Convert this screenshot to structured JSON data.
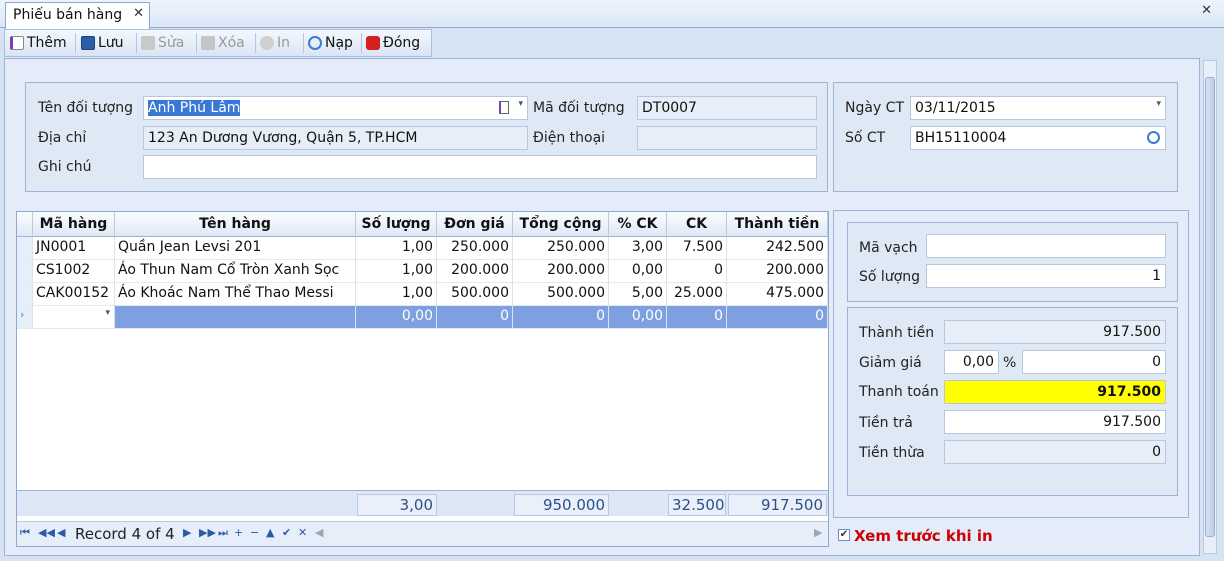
{
  "tab": {
    "title": "Phiếu bán hàng"
  },
  "toolbar": {
    "add": "Thêm",
    "save": "Lưu",
    "edit": "Sửa",
    "delete": "Xóa",
    "print": "In",
    "reload": "Nạp",
    "close": "Đóng"
  },
  "customer": {
    "name_label": "Tên đối tượng",
    "name_value": "Anh Phú Lâm",
    "code_label": "Mã đối tượng",
    "code_value": "DT0007",
    "address_label": "Địa chỉ",
    "address_value": "123 An Dương Vương, Quận 5, TP.HCM",
    "phone_label": "Điện thoại",
    "phone_value": "",
    "note_label": "Ghi chú",
    "note_value": ""
  },
  "doc": {
    "date_label": "Ngày CT",
    "date_value": "03/11/2015",
    "no_label": "Số CT",
    "no_value": "BH15110004"
  },
  "grid": {
    "headers": [
      "Mã hàng",
      "Tên hàng",
      "Số lượng",
      "Đơn giá",
      "Tổng cộng",
      "% CK",
      "CK",
      "Thành tiền"
    ],
    "rows": [
      [
        "JN0001",
        "Quần Jean Levsi 201",
        "1,00",
        "250.000",
        "250.000",
        "3,00",
        "7.500",
        "242.500"
      ],
      [
        "CS1002",
        "Áo Thun Nam Cổ Tròn Xanh Sọc",
        "1,00",
        "200.000",
        "200.000",
        "0,00",
        "0",
        "200.000"
      ],
      [
        "CAK00152",
        "Áo Khoác Nam Thể Thao Messi",
        "1,00",
        "500.000",
        "500.000",
        "5,00",
        "25.000",
        "475.000"
      ]
    ],
    "new_row": [
      "",
      "",
      "0,00",
      "0",
      "0",
      "0,00",
      "0",
      "0"
    ],
    "totals": {
      "qty": "3,00",
      "total": "950.000",
      "discount": "32.500",
      "amount": "917.500"
    },
    "record_label": "Record 4 of 4"
  },
  "barcode": {
    "code_label": "Mã vạch",
    "code_value": "",
    "qty_label": "Số lượng",
    "qty_value": "1"
  },
  "summary": {
    "amount_label": "Thành tiền",
    "amount_value": "917.500",
    "discount_label": "Giảm giá",
    "discount_pct": "0,00",
    "pct_sign": "%",
    "discount_value": "0",
    "pay_label": "Thanh toán",
    "pay_value": "917.500",
    "paid_label": "Tiền trả",
    "paid_value": "917.500",
    "change_label": "Tiền thừa",
    "change_value": "0"
  },
  "preview": {
    "label": "Xem trước khi in",
    "checked": true
  },
  "colors": {
    "highlight": "#ffff00",
    "accent": "#cc0000",
    "selected_row": "#7e9fe0"
  }
}
